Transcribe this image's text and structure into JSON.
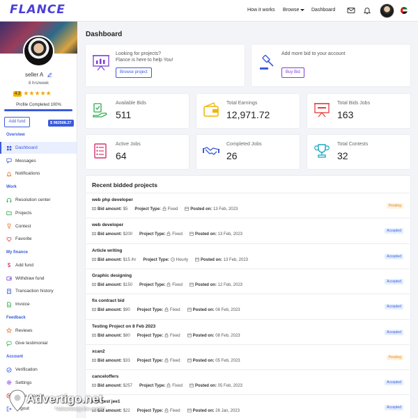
{
  "brand": {
    "logo": "FLANCE"
  },
  "topnav": {
    "how_it_works": "How it works",
    "browse": "Browse",
    "dashboard": "Dashboard"
  },
  "sidebar": {
    "user_name": "seller A",
    "hours": "8 hrs/week",
    "rating": "4.3",
    "stars": 5,
    "profile_completed_label": "Profile Completed 100%",
    "profile_completed_percent": 100,
    "add_fund_label": "Add fund",
    "balance": "$ 982568.27",
    "sections": [
      {
        "title": "Overview",
        "items": [
          {
            "label": "Dashboard",
            "icon": "grid-icon",
            "active": true
          },
          {
            "label": "Messages",
            "icon": "message-icon"
          },
          {
            "label": "Notifications",
            "icon": "bell-icon"
          }
        ]
      },
      {
        "title": "Work",
        "items": [
          {
            "label": "Resolution center",
            "icon": "headset-icon"
          },
          {
            "label": "Projects",
            "icon": "folder-icon"
          },
          {
            "label": "Contest",
            "icon": "trophy-icon"
          },
          {
            "label": "Favorite",
            "icon": "heart-icon"
          }
        ]
      },
      {
        "title": "My finance",
        "items": [
          {
            "label": "Add fund",
            "icon": "dollar-icon"
          },
          {
            "label": "Withdraw fund",
            "icon": "wallet-icon"
          },
          {
            "label": "Transaction history",
            "icon": "receipt-icon"
          },
          {
            "label": "Invoice",
            "icon": "invoice-icon"
          }
        ]
      },
      {
        "title": "Feedback",
        "items": [
          {
            "label": "Reviews",
            "icon": "star-icon"
          },
          {
            "label": "Give testimonial",
            "icon": "chat-icon"
          }
        ]
      },
      {
        "title": "Account",
        "items": [
          {
            "label": "Verification",
            "icon": "check-circle-icon"
          },
          {
            "label": "Settings",
            "icon": "gear-icon"
          },
          {
            "label": "Close account",
            "icon": "close-icon"
          },
          {
            "label": "Logout",
            "icon": "logout-icon"
          }
        ]
      }
    ]
  },
  "main": {
    "title": "Dashboard",
    "promos": [
      {
        "line1": "Looking for projects?",
        "line2": "Flance is here to help You!",
        "button": "Browse project",
        "icon": "presentation-icon"
      },
      {
        "line1": "Add more bid to your account",
        "line2": "",
        "button": "Buy Bid",
        "icon": "gavel-icon"
      }
    ],
    "stats": [
      {
        "label": "Available Bids",
        "value": "511",
        "icon": "hand-money-icon",
        "color": "#2eaa4a"
      },
      {
        "label": "Total Earnings",
        "value": "12,971.72",
        "icon": "wallet-icon",
        "color": "#f0b400"
      },
      {
        "label": "Total Bids Jobs",
        "value": "163",
        "icon": "presentation-icon",
        "color": "#e23b3b"
      },
      {
        "label": "Active Jobs",
        "value": "64",
        "icon": "checklist-icon",
        "color": "#d6336c"
      },
      {
        "label": "Completed Jobs",
        "value": "26",
        "icon": "handshake-icon",
        "color": "#3b5bdb"
      },
      {
        "label": "Total Contests",
        "value": "32",
        "icon": "trophy-icon",
        "color": "#1aa6c0"
      }
    ],
    "recent": {
      "title": "Recent bidded projects",
      "bid_amount_label": "Bid amount:",
      "project_type_label": "Project Type:",
      "posted_on_label": "Posted on:",
      "projects": [
        {
          "title": "web php developer",
          "bid": "$5",
          "type": "Fixed",
          "posted": "13 Feb, 2023",
          "status": "Pending"
        },
        {
          "title": "web developer",
          "bid": "$200",
          "type": "Fixed",
          "posted": "13 Feb, 2023",
          "status": "Accepted"
        },
        {
          "title": "Article writing",
          "bid": "$15 /hr",
          "type": "Hourly",
          "posted": "13 Feb, 2023",
          "status": "Accepted"
        },
        {
          "title": "Graphic designing",
          "bid": "$150",
          "type": "Fixed",
          "posted": "12 Feb, 2023",
          "status": "Accepted"
        },
        {
          "title": "fix contract bid",
          "bid": "$90",
          "type": "Fixed",
          "posted": "08 Feb, 2023",
          "status": "Accepted"
        },
        {
          "title": "Testing Project on 8 Feb 2023",
          "bid": "$80",
          "type": "Fixed",
          "posted": "08 Feb, 2023",
          "status": "Accepted"
        },
        {
          "title": "xcan2",
          "bid": "$33",
          "type": "Fixed",
          "posted": "05 Feb, 2023",
          "status": "Pending"
        },
        {
          "title": "canceloffers",
          "bid": "$257",
          "type": "Fixed",
          "posted": "05 Feb, 2023",
          "status": "Accepted"
        },
        {
          "title": "new test jee1",
          "bid": "$22",
          "type": "Fixed",
          "posted": "26 Jan, 2023",
          "status": "Accepted"
        }
      ]
    }
  },
  "watermark": {
    "text": "Advertigo.net",
    "sub": "\"Advertising the world\""
  }
}
